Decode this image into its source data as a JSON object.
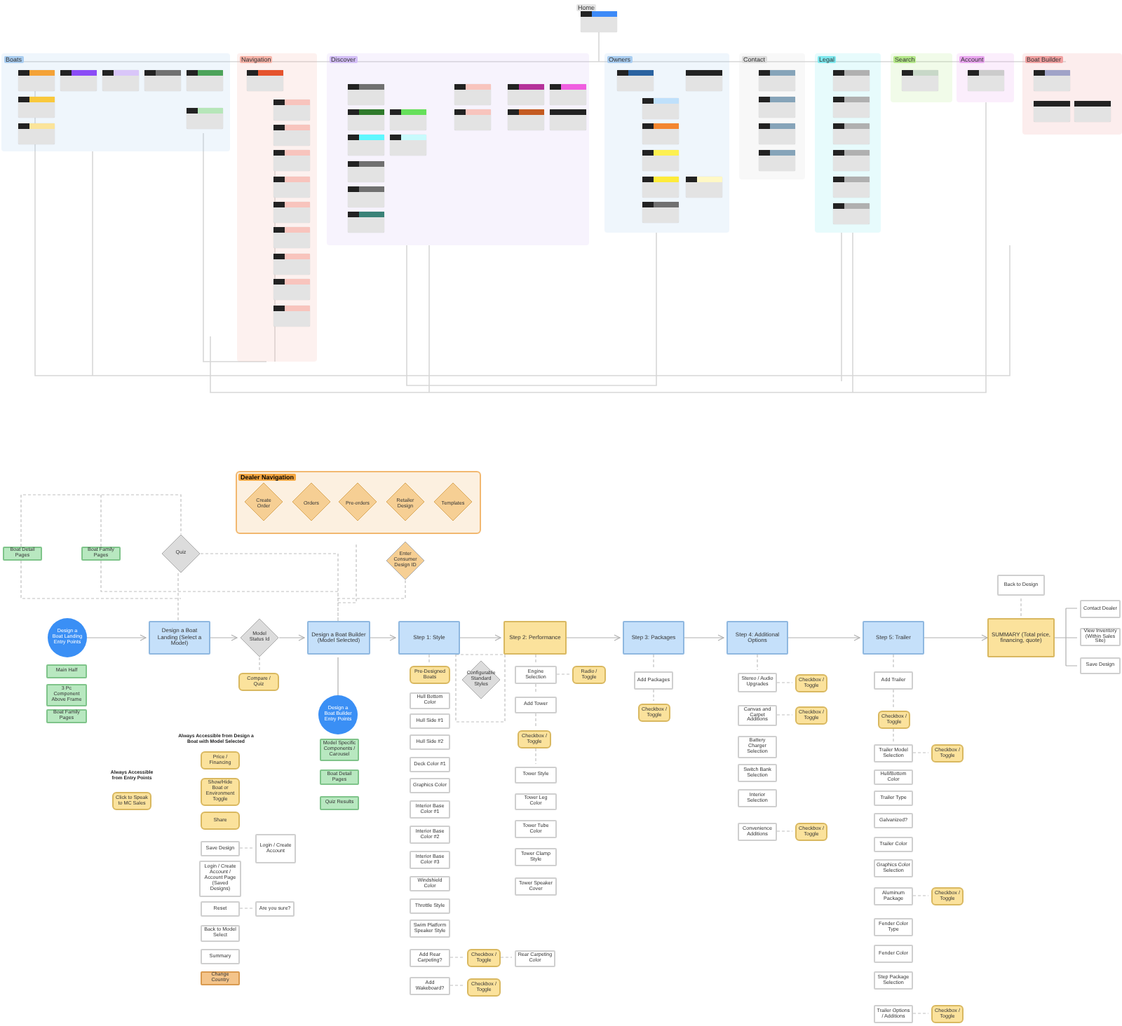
{
  "sitemap": {
    "home": {
      "label": "Home",
      "color": "#3d8af7"
    },
    "groups": [
      {
        "label": "Boats",
        "color": "#a9cdf0",
        "cards": [
          {
            "color": "#f4a236"
          },
          {
            "color": "#8b4cf6"
          },
          {
            "color": "#d9c6f9"
          },
          {
            "color": "#707070"
          },
          {
            "color": "#4ca35a"
          },
          {
            "color": "#f9c83c"
          },
          {
            "color": "#fbe49a"
          },
          {
            "color": "#b6e6b9"
          }
        ]
      },
      {
        "label": "Navigation",
        "color": "#f6b3a8",
        "cards": [
          {
            "color": "#e5532d"
          },
          {
            "color": "#f8c4bd"
          },
          {
            "color": "#f8c4bd"
          },
          {
            "color": "#f8c4bd"
          },
          {
            "color": "#f8c4bd"
          },
          {
            "color": "#f8c4bd"
          },
          {
            "color": "#f8c4bd"
          },
          {
            "color": "#f8c4bd"
          },
          {
            "color": "#f8c4bd"
          },
          {
            "color": "#f8c4bd"
          }
        ]
      },
      {
        "label": "Discover",
        "color": "#d4bff7",
        "cards": [
          {
            "color": "#707070"
          },
          {
            "color": "#2f7a2b"
          },
          {
            "color": "#66e05a"
          },
          {
            "color": "#5ff7ff"
          },
          {
            "color": "#c8fafc"
          },
          {
            "color": "#707070"
          },
          {
            "color": "#707070"
          },
          {
            "color": "#3a8277"
          },
          {
            "color": "#f8c4bd"
          },
          {
            "color": "#f8c4bd"
          },
          {
            "color": "#b5319a"
          },
          {
            "color": "#c45a21"
          },
          {
            "color": "#f05ee0"
          },
          {
            "color": "#222222"
          }
        ]
      },
      {
        "label": "Owners",
        "color": "#a9cdf0",
        "cards": [
          {
            "color": "#2a62a0"
          },
          {
            "color": "#222222"
          },
          {
            "color": "#bfe0fb"
          },
          {
            "color": "#f3862f"
          },
          {
            "color": "#fdf050"
          },
          {
            "color": "#fdeb3a"
          },
          {
            "color": "#fff8c5"
          },
          {
            "color": "#707070"
          }
        ]
      },
      {
        "label": "Contact",
        "color": "#dcdcdc",
        "cards": [
          {
            "color": "#86a4b9"
          },
          {
            "color": "#86a4b9"
          },
          {
            "color": "#86a4b9"
          },
          {
            "color": "#86a4b9"
          }
        ]
      },
      {
        "label": "Legal",
        "color": "#7ee8ee",
        "cards": [
          {
            "color": "#b0b0b0"
          },
          {
            "color": "#b0b0b0"
          },
          {
            "color": "#b0b0b0"
          },
          {
            "color": "#b0b0b0"
          },
          {
            "color": "#b0b0b0"
          },
          {
            "color": "#b0b0b0"
          }
        ]
      },
      {
        "label": "Search",
        "color": "#b5e88a",
        "cards": [
          {
            "color": "#c8d8c8"
          }
        ]
      },
      {
        "label": "Account",
        "color": "#e9a6ef",
        "cards": [
          {
            "color": "#cccccc"
          }
        ]
      },
      {
        "label": "Boat Builder",
        "color": "#f0a0a0",
        "cards": [
          {
            "color": "#a0a3c8"
          },
          {
            "color": "#222222"
          },
          {
            "color": "#222222"
          }
        ]
      }
    ]
  },
  "dealer_navigation": {
    "label": "Dealer Navigation",
    "items": [
      "Create Order",
      "Orders",
      "Pre-orders",
      "Retailer Design",
      "Templates"
    ]
  },
  "nodes": [
    {
      "kind": "page",
      "text": "Boat Detail Pages"
    },
    {
      "kind": "page",
      "text": "Boat Family Pages"
    },
    {
      "kind": "decision",
      "text": "Quiz"
    },
    {
      "kind": "dealer",
      "text": "Enter Consumer Design ID"
    },
    {
      "kind": "entry",
      "text": "Design a Boat Landing Entry Points"
    },
    {
      "kind": "step",
      "text": "Design a Boat Landing (Select a Model)"
    },
    {
      "kind": "decision",
      "text": "Model Status Id"
    },
    {
      "kind": "control",
      "text": "Compare / Quiz"
    },
    {
      "kind": "step",
      "text": "Design a Boat Builder (Model Selected)"
    },
    {
      "kind": "step",
      "text": "Step 1: Style"
    },
    {
      "kind": "key-step",
      "text": "Step 2: Performance"
    },
    {
      "kind": "step",
      "text": "Step 3: Packages"
    },
    {
      "kind": "step",
      "text": "Step 4: Additional Options"
    },
    {
      "kind": "step",
      "text": "Step 5: Trailer"
    },
    {
      "kind": "option",
      "text": "Back to Design"
    },
    {
      "kind": "key-step",
      "text": "SUMMARY (Total price, financing, quote)"
    },
    {
      "kind": "option",
      "text": "Contact Dealer"
    },
    {
      "kind": "option",
      "text": "View Inventory (Within Sales Site)"
    },
    {
      "kind": "option",
      "text": "Save Design"
    },
    {
      "kind": "page",
      "text": "Main Half"
    },
    {
      "kind": "page",
      "text": "3 Pc Component Above Frame"
    },
    {
      "kind": "page",
      "text": "Boat Family Pages"
    },
    {
      "kind": "entry",
      "text": "Design a Boat Builder Entry Points"
    },
    {
      "kind": "page",
      "text": "Model Specific Components / Carousel"
    },
    {
      "kind": "page",
      "text": "Boat Detail Pages"
    },
    {
      "kind": "page",
      "text": "Quiz Results"
    },
    {
      "kind": "control",
      "text": "Pre-Designed Boats"
    },
    {
      "kind": "decision",
      "text": "Configurable Standard Styles"
    },
    {
      "kind": "option",
      "text": "Hull Bottom Color"
    },
    {
      "kind": "option",
      "text": "Hull Side #1"
    },
    {
      "kind": "option",
      "text": "Hull Side #2"
    },
    {
      "kind": "option",
      "text": "Deck Color #1"
    },
    {
      "kind": "option",
      "text": "Graphics Color"
    },
    {
      "kind": "option",
      "text": "Interior Base Color #1"
    },
    {
      "kind": "option",
      "text": "Interior Base Color #2"
    },
    {
      "kind": "option",
      "text": "Interior Base Color #3"
    },
    {
      "kind": "option",
      "text": "Windshield Color"
    },
    {
      "kind": "option",
      "text": "Throttle Style"
    },
    {
      "kind": "option",
      "text": "Swim Platform Speaker Style"
    },
    {
      "kind": "option",
      "text": "Add Rear Carpeting?"
    },
    {
      "kind": "control",
      "text": "Checkbox / Toggle"
    },
    {
      "kind": "option",
      "text": "Rear Carpeting Color"
    },
    {
      "kind": "option",
      "text": "Add Wakeboard?"
    },
    {
      "kind": "control",
      "text": "Checkbox / Toggle"
    },
    {
      "kind": "option",
      "text": "Engine Selection"
    },
    {
      "kind": "control",
      "text": "Radio / Toggle"
    },
    {
      "kind": "option",
      "text": "Add Tower"
    },
    {
      "kind": "control",
      "text": "Checkbox / Toggle"
    },
    {
      "kind": "option",
      "text": "Tower Style"
    },
    {
      "kind": "option",
      "text": "Tower Leg Color"
    },
    {
      "kind": "option",
      "text": "Tower Tube Color"
    },
    {
      "kind": "option",
      "text": "Tower Clamp Style"
    },
    {
      "kind": "option",
      "text": "Tower Speaker Cover"
    },
    {
      "kind": "option",
      "text": "Add Packages"
    },
    {
      "kind": "control",
      "text": "Checkbox / Toggle"
    },
    {
      "kind": "option",
      "text": "Stereo / Audio Upgrades"
    },
    {
      "kind": "control",
      "text": "Checkbox / Toggle"
    },
    {
      "kind": "option",
      "text": "Canvas and Carpet Additions"
    },
    {
      "kind": "control",
      "text": "Checkbox / Toggle"
    },
    {
      "kind": "option",
      "text": "Battery Charger Selection"
    },
    {
      "kind": "option",
      "text": "Switch Bank Selection"
    },
    {
      "kind": "option",
      "text": "Interior Selection"
    },
    {
      "kind": "option",
      "text": "Convenience Additions"
    },
    {
      "kind": "control",
      "text": "Checkbox / Toggle"
    },
    {
      "kind": "option",
      "text": "Add Trailer"
    },
    {
      "kind": "control",
      "text": "Checkbox / Toggle"
    },
    {
      "kind": "option",
      "text": "Trailer Model Selection"
    },
    {
      "kind": "control",
      "text": "Checkbox / Toggle"
    },
    {
      "kind": "option",
      "text": "Hull/Bottom Color"
    },
    {
      "kind": "option",
      "text": "Trailer Type"
    },
    {
      "kind": "option",
      "text": "Galvanized?"
    },
    {
      "kind": "option",
      "text": "Trailer Color"
    },
    {
      "kind": "option",
      "text": "Graphics Color Selection"
    },
    {
      "kind": "option",
      "text": "Aluminum Package"
    },
    {
      "kind": "control",
      "text": "Checkbox / Toggle"
    },
    {
      "kind": "option",
      "text": "Fender Color Type"
    },
    {
      "kind": "option",
      "text": "Fender Color"
    },
    {
      "kind": "option",
      "text": "Step Package Selection"
    },
    {
      "kind": "option",
      "text": "Trailer Options / Additions"
    },
    {
      "kind": "control",
      "text": "Checkbox / Toggle"
    },
    {
      "kind": "note",
      "text": "Always Accessible from Design a Boat with Model Selected"
    },
    {
      "kind": "control",
      "text": "Price / Financing"
    },
    {
      "kind": "control",
      "text": "Show/Hide Boat or Environment Toggle"
    },
    {
      "kind": "control",
      "text": "Share"
    },
    {
      "kind": "option",
      "text": "Save Design"
    },
    {
      "kind": "option",
      "text": "Login / Create Account"
    },
    {
      "kind": "option",
      "text": "Login / Create Account / Account Page (Saved Designs)"
    },
    {
      "kind": "option",
      "text": "Reset"
    },
    {
      "kind": "option",
      "text": "Are you sure?"
    },
    {
      "kind": "option",
      "text": "Back to Model Select"
    },
    {
      "kind": "option",
      "text": "Summary"
    },
    {
      "kind": "highlight",
      "text": "Change Country"
    },
    {
      "kind": "note",
      "text": "Always Accessible from Entry Points"
    },
    {
      "kind": "control",
      "text": "Click to Speak to MC Sales"
    }
  ]
}
